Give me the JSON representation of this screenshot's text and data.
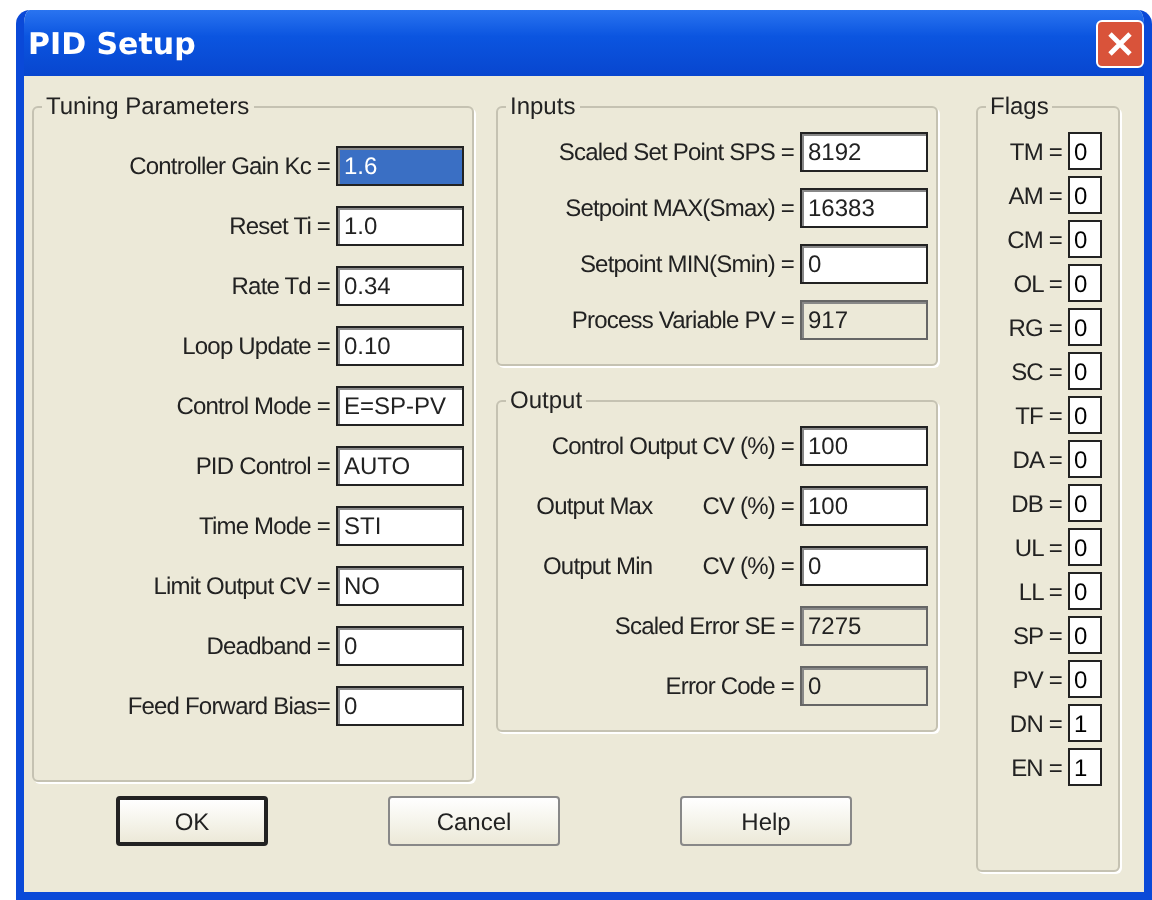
{
  "window": {
    "title": "PID Setup"
  },
  "tuning": {
    "title": "Tuning Parameters",
    "fields": [
      {
        "label": "Controller Gain Kc =",
        "value": "1.6",
        "selected": true,
        "readonly": false
      },
      {
        "label": "Reset Ti  =",
        "value": "1.0",
        "selected": false,
        "readonly": false
      },
      {
        "label": "Rate Td =",
        "value": "0.34",
        "selected": false,
        "readonly": false
      },
      {
        "label": "Loop Update =",
        "value": "0.10",
        "selected": false,
        "readonly": false
      },
      {
        "label": "Control Mode =",
        "value": "E=SP-PV",
        "selected": false,
        "readonly": false
      },
      {
        "label": "PID Control =",
        "value": "AUTO",
        "selected": false,
        "readonly": false
      },
      {
        "label": "Time Mode =",
        "value": "STI",
        "selected": false,
        "readonly": false
      },
      {
        "label": "Limit Output CV =",
        "value": "NO",
        "selected": false,
        "readonly": false
      },
      {
        "label": "Deadband =",
        "value": "0",
        "selected": false,
        "readonly": false
      },
      {
        "label": "Feed Forward Bias=",
        "value": "0",
        "selected": false,
        "readonly": false
      }
    ]
  },
  "inputs": {
    "title": "Inputs",
    "fields": [
      {
        "label": "Scaled Set Point SPS =",
        "value": "8192",
        "selected": false,
        "readonly": false
      },
      {
        "label": "Setpoint MAX(Smax) =",
        "value": "16383",
        "selected": false,
        "readonly": false
      },
      {
        "label": "Setpoint MIN(Smin) =",
        "value": "0",
        "selected": false,
        "readonly": false
      },
      {
        "label": "Process Variable PV =",
        "value": "917",
        "selected": false,
        "readonly": true
      }
    ]
  },
  "output": {
    "title": "Output",
    "fields": [
      {
        "label": "Control Output CV (%) =",
        "value": "100",
        "selected": false,
        "readonly": false
      },
      {
        "label": "Output Max",
        "unit": "CV (%) =",
        "value": "100",
        "selected": false,
        "readonly": false
      },
      {
        "label": "Output Min",
        "unit": "CV (%) =",
        "value": "0",
        "selected": false,
        "readonly": false
      },
      {
        "label": "Scaled Error SE =",
        "value": "7275",
        "selected": false,
        "readonly": true
      },
      {
        "label": "Error Code =",
        "value": "0",
        "selected": false,
        "readonly": true
      }
    ]
  },
  "flags": {
    "title": "Flags",
    "items": [
      {
        "label": "TM =",
        "value": "0"
      },
      {
        "label": "AM =",
        "value": "0"
      },
      {
        "label": "CM =",
        "value": "0"
      },
      {
        "label": "OL =",
        "value": "0"
      },
      {
        "label": "RG =",
        "value": "0"
      },
      {
        "label": "SC =",
        "value": "0"
      },
      {
        "label": "TF =",
        "value": "0"
      },
      {
        "label": "DA =",
        "value": "0"
      },
      {
        "label": "DB =",
        "value": "0"
      },
      {
        "label": "UL =",
        "value": "0"
      },
      {
        "label": "LL =",
        "value": "0"
      },
      {
        "label": "SP =",
        "value": "0"
      },
      {
        "label": "PV =",
        "value": "0"
      },
      {
        "label": "DN =",
        "value": "1"
      },
      {
        "label": "EN =",
        "value": "1"
      }
    ]
  },
  "buttons": [
    {
      "label": "OK",
      "default": true
    },
    {
      "label": "Cancel",
      "default": false
    },
    {
      "label": "Help",
      "default": false
    }
  ]
}
